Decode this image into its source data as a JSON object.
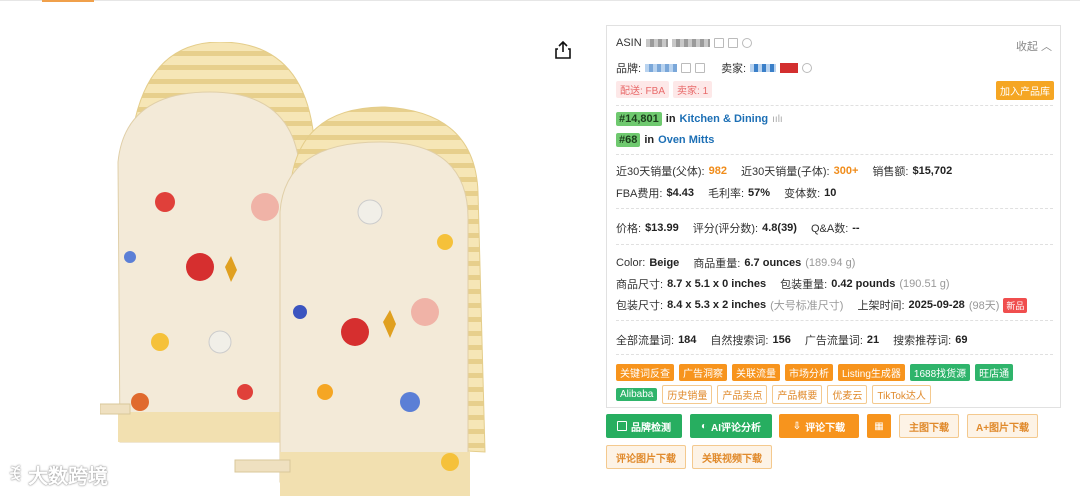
{
  "panel": {
    "asin_label": "ASIN",
    "collapse_label": "收起",
    "brand_label": "品牌:",
    "seller_label": "卖家:",
    "ship_tag": "配送: FBA",
    "seller_count_tag": "卖家: 1",
    "add_button": "加入产品库",
    "rank1": {
      "rank": "#14,801",
      "in": "in",
      "category": "Kitchen & Dining"
    },
    "rank2": {
      "rank": "#68",
      "in": "in",
      "category": "Oven Mitts"
    },
    "sales_parent_label": "近30天销量(父体):",
    "sales_parent_value": "982",
    "sales_child_label": "近30天销量(子体):",
    "sales_child_value": "300+",
    "revenue_label": "销售额:",
    "revenue_value": "$15,702",
    "fba_label": "FBA费用:",
    "fba_value": "$4.43",
    "margin_label": "毛利率:",
    "margin_value": "57%",
    "variants_label": "变体数:",
    "variants_value": "10",
    "price_label": "价格:",
    "price_value": "$13.99",
    "rating_label": "评分(评分数):",
    "rating_value": "4.8(39)",
    "qa_label": "Q&A数:",
    "qa_value": "--",
    "color_label": "Color:",
    "color_value": "Beige",
    "weight_label": "商品重量:",
    "weight_value": "6.7 ounces",
    "weight_alt": "(189.94 g)",
    "size_label": "商品尺寸:",
    "size_value": "8.7 x 5.1 x 0 inches",
    "pkg_weight_label": "包装重量:",
    "pkg_weight_value": "0.42 pounds",
    "pkg_weight_alt": "(190.51 g)",
    "pkg_size_label": "包装尺寸:",
    "pkg_size_value": "8.4 x 5.3 x 2 inches",
    "pkg_size_alt": "(大号标准尺寸)",
    "listed_label": "上架时间:",
    "listed_value": "2025-09-28",
    "listed_alt": "(98天)",
    "new_tag": "新品",
    "kw_total_label": "全部流量词:",
    "kw_total_value": "184",
    "kw_organic_label": "自然搜索词:",
    "kw_organic_value": "156",
    "kw_ad_label": "广告流量词:",
    "kw_ad_value": "21",
    "kw_rec_label": "搜索推荐词:",
    "kw_rec_value": "69",
    "tags_row1": [
      "关键词反查",
      "广告洞察",
      "关联流量",
      "市场分析",
      "Listing生成器"
    ],
    "tags_row1_green": [
      "1688找货源",
      "旺店通"
    ],
    "tag_alibaba": "Alibaba",
    "tags_row2": [
      "历史销量",
      "产品卖点",
      "产品概要",
      "优麦云",
      "TikTok达人"
    ]
  },
  "actions": {
    "brand_check": "品牌检测",
    "ai_review": "AI评论分析",
    "review_download": "评论下载",
    "main_image_download": "主图下载",
    "aplus_download": "A+图片下载",
    "review_image_download": "评论图片下载",
    "related_video_download": "关联视频下载"
  },
  "watermark": "大数跨境",
  "colors": {
    "orange": "#f7941d",
    "green": "#27ae60",
    "link": "#1c6fb5",
    "rank_green": "#6fc96f"
  }
}
